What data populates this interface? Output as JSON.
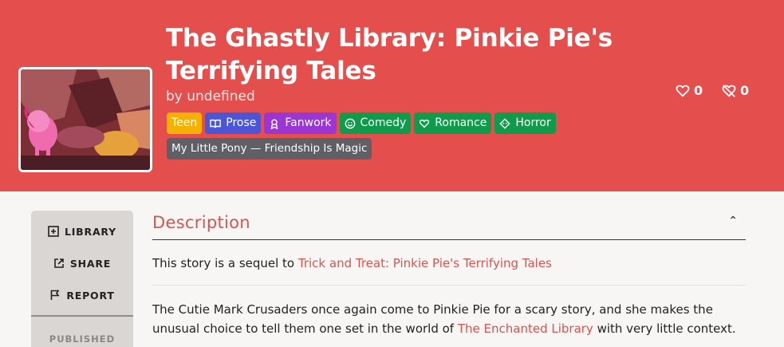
{
  "story": {
    "title": "The Ghastly Library: Pinkie Pie's Terrifying Tales",
    "byline": "by undefined"
  },
  "tags": [
    {
      "label": "Teen",
      "color": "#f6b100",
      "icon": ""
    },
    {
      "label": "Prose",
      "color": "#4c55d8",
      "icon": "book-icon"
    },
    {
      "label": "Fanwork",
      "color": "#9b35d3",
      "icon": "fanwork-icon"
    },
    {
      "label": "Comedy",
      "color": "#0f9b49",
      "icon": "smile-icon"
    },
    {
      "label": "Romance",
      "color": "#0f9b49",
      "icon": "hearts-icon"
    },
    {
      "label": "Horror",
      "color": "#0f9b49",
      "icon": "ghost-icon"
    }
  ],
  "fandom": "My Little Pony — Friendship Is Magic",
  "votes": {
    "likes": "0",
    "dislikes": "0"
  },
  "sidebar": {
    "library": "LIBRARY",
    "share": "SHARE",
    "report": "REPORT",
    "published": "PUBLISHED"
  },
  "description": {
    "heading": "Description",
    "sequel_prefix": "This story is a sequel to ",
    "sequel_link": "Trick and Treat: Pinkie Pie's Terrifying Tales",
    "body_1": "The Cutie Mark Crusaders once again come to Pinkie Pie for a scary story, and she makes the unusual choice to tell them one set in the world of ",
    "body_link": "The Enchanted Library",
    "body_2": " with very little context."
  },
  "colors": {
    "hero": "#e44f4d",
    "accent": "#d9534f"
  }
}
